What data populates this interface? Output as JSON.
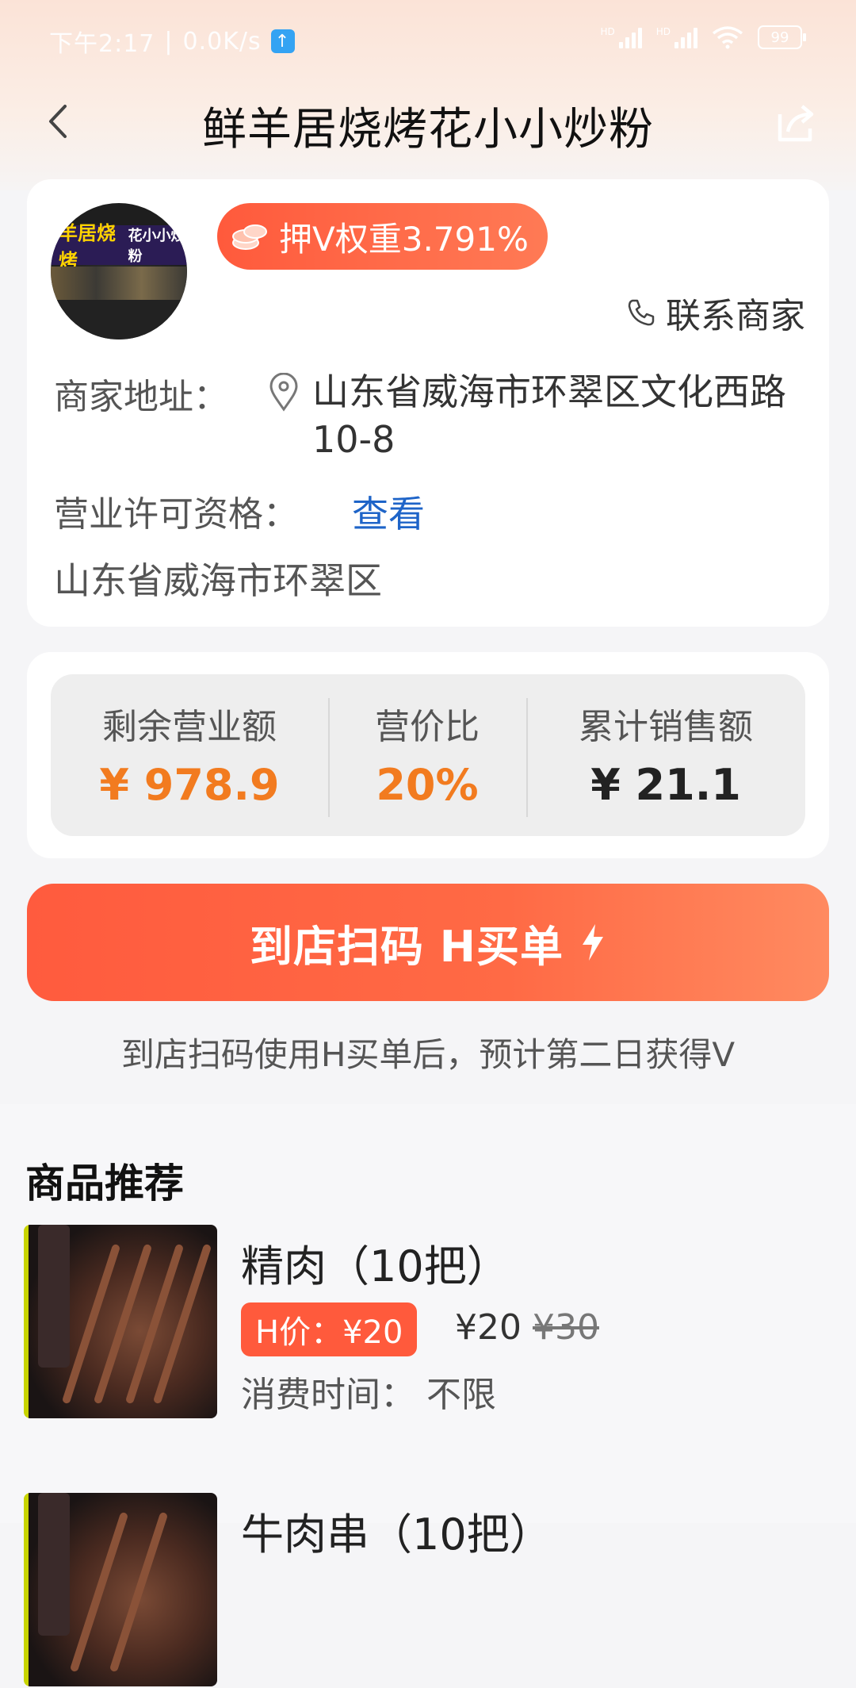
{
  "status_bar": {
    "time_text": "下午2:17",
    "speed": "0.0K/s",
    "battery": "99"
  },
  "header": {
    "title": "鲜羊居烧烤花小小炒粉"
  },
  "merchant": {
    "avatar_sign": "羊居烧烤",
    "avatar_sign_secondary": "花小小炒粉",
    "weight_label": "押V权重3.791%",
    "contact_label": "联系商家",
    "address_label": "商家地址：",
    "address_value": "山东省威海市环翠区文化西路10-8",
    "license_label": "营业许可资格：",
    "license_link": "查看",
    "region": "山东省威海市环翠区"
  },
  "stats": [
    {
      "label": "剩余营业额",
      "value": "¥ 978.9"
    },
    {
      "label": "营价比",
      "value": "20%"
    },
    {
      "label": "累计销售额",
      "value": "¥ 21.1"
    }
  ],
  "cta": {
    "label": "到店扫码 H买单",
    "hint": "到店扫码使用H买单后，预计第二日获得V"
  },
  "recommend": {
    "title": "商品推荐",
    "items": [
      {
        "name": "精肉（10把）",
        "h_price": "H价：¥20",
        "price": "¥20",
        "original_price": "¥30",
        "time": "消费时间：  不限"
      },
      {
        "name": "牛肉串（10把）"
      }
    ]
  },
  "colors": {
    "accent": "#ff5a3c",
    "orange_value": "#f27b1f",
    "link": "#1e64c8"
  }
}
